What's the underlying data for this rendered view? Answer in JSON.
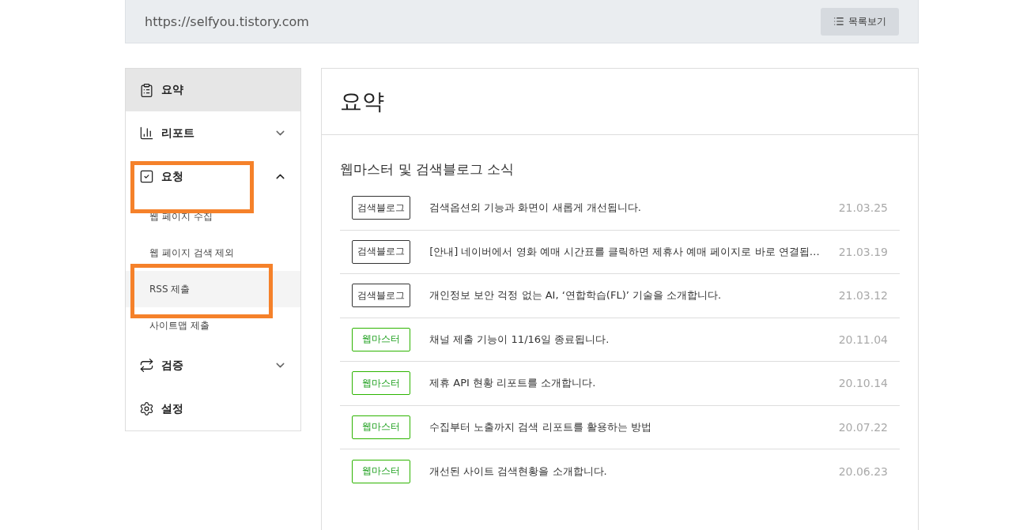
{
  "top_bar": {
    "url": "https://selfyou.tistory.com",
    "list_button": "목록보기"
  },
  "sidebar": {
    "items": [
      {
        "label": "요약",
        "selected": true,
        "highlighted": false
      },
      {
        "label": "리포트",
        "selected": false,
        "highlighted": false,
        "expanded": false
      },
      {
        "label": "요청",
        "selected": false,
        "highlighted": true,
        "expanded": true,
        "children": [
          {
            "label": "웹 페이지 수집",
            "selected": false,
            "highlighted": false
          },
          {
            "label": "웹 페이지 검색 제외",
            "selected": false,
            "highlighted": false
          },
          {
            "label": "RSS 제출",
            "selected": true,
            "highlighted": true
          },
          {
            "label": "사이트맵 제출",
            "selected": false,
            "highlighted": false
          }
        ]
      },
      {
        "label": "검증",
        "selected": false,
        "highlighted": false,
        "expanded": false
      },
      {
        "label": "설정",
        "selected": false,
        "highlighted": false
      }
    ]
  },
  "main": {
    "title": "요약",
    "section_title": "웹마스터 및 검색블로그 소식",
    "news": [
      {
        "tag": "검색블로그",
        "kind": "blog",
        "title": "검색옵션의 기능과 화면이 새롭게 개선됩니다.",
        "date": "21.03.25"
      },
      {
        "tag": "검색블로그",
        "kind": "blog",
        "title": "[안내] 네이버에서 영화 예매 시간표를 클릭하면 제휴사 예매 페이지로 바로 연결됩…",
        "date": "21.03.19"
      },
      {
        "tag": "검색블로그",
        "kind": "blog",
        "title": "개인정보 보안 걱정 없는 AI, ‘연합학습(FL)’ 기술을 소개합니다.",
        "date": "21.03.12"
      },
      {
        "tag": "웹마스터",
        "kind": "webmaster",
        "title": "채널 제출 기능이 11/16일 종료됩니다.",
        "date": "20.11.04"
      },
      {
        "tag": "웹마스터",
        "kind": "webmaster",
        "title": "제휴 API 현황 리포트를 소개합니다.",
        "date": "20.10.14"
      },
      {
        "tag": "웹마스터",
        "kind": "webmaster",
        "title": "수집부터 노출까지 검색 리포트를 활용하는 방법",
        "date": "20.07.22"
      },
      {
        "tag": "웹마스터",
        "kind": "webmaster",
        "title": "개선된 사이트 검색현황을 소개합니다.",
        "date": "20.06.23"
      }
    ]
  }
}
